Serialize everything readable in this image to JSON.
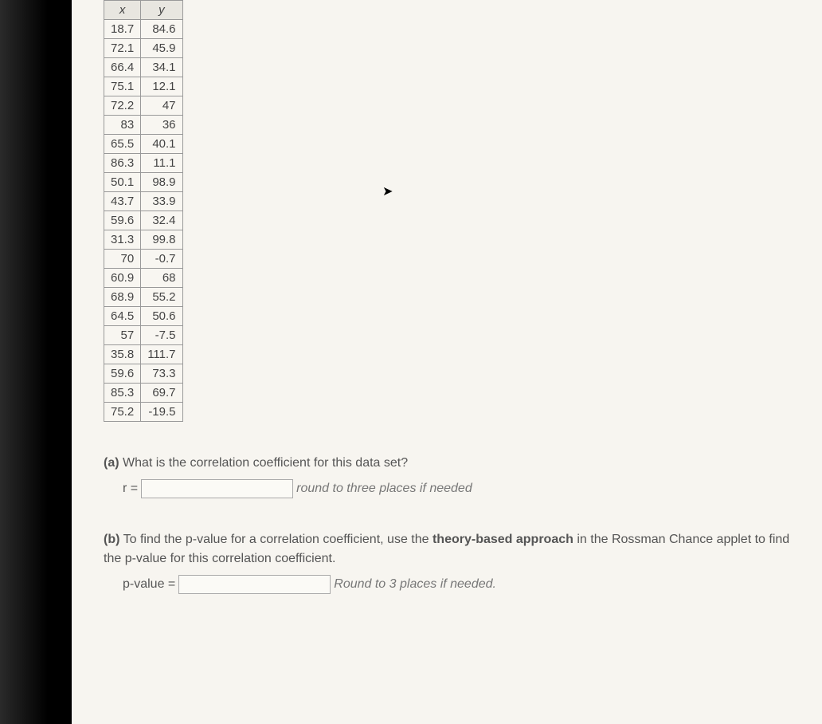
{
  "table": {
    "headers": [
      "x",
      "y"
    ],
    "rows": [
      [
        "18.7",
        "84.6"
      ],
      [
        "72.1",
        "45.9"
      ],
      [
        "66.4",
        "34.1"
      ],
      [
        "75.1",
        "12.1"
      ],
      [
        "72.2",
        "47"
      ],
      [
        "83",
        "36"
      ],
      [
        "65.5",
        "40.1"
      ],
      [
        "86.3",
        "11.1"
      ],
      [
        "50.1",
        "98.9"
      ],
      [
        "43.7",
        "33.9"
      ],
      [
        "59.6",
        "32.4"
      ],
      [
        "31.3",
        "99.8"
      ],
      [
        "70",
        "-0.7"
      ],
      [
        "60.9",
        "68"
      ],
      [
        "68.9",
        "55.2"
      ],
      [
        "64.5",
        "50.6"
      ],
      [
        "57",
        "-7.5"
      ],
      [
        "35.8",
        "111.7"
      ],
      [
        "59.6",
        "73.3"
      ],
      [
        "85.3",
        "69.7"
      ],
      [
        "75.2",
        "-19.5"
      ]
    ]
  },
  "question_a": {
    "label": "(a)",
    "text": "What is the correlation coefficient for this data set?",
    "var": "r =",
    "hint": "round to three places if needed"
  },
  "question_b": {
    "label": "(b)",
    "text_part1": "To find the p-value for a correlation coefficient, use the ",
    "bold": "theory-based approach",
    "text_part2": " in the Rossman Chance applet to find the p-value for this correlation coefficient.",
    "var": "p-value =",
    "hint": "Round to 3 places if needed."
  },
  "chart_data": {
    "type": "table",
    "columns": [
      "x",
      "y"
    ],
    "data": [
      [
        18.7,
        84.6
      ],
      [
        72.1,
        45.9
      ],
      [
        66.4,
        34.1
      ],
      [
        75.1,
        12.1
      ],
      [
        72.2,
        47
      ],
      [
        83,
        36
      ],
      [
        65.5,
        40.1
      ],
      [
        86.3,
        11.1
      ],
      [
        50.1,
        98.9
      ],
      [
        43.7,
        33.9
      ],
      [
        59.6,
        32.4
      ],
      [
        31.3,
        99.8
      ],
      [
        70,
        -0.7
      ],
      [
        60.9,
        68
      ],
      [
        68.9,
        55.2
      ],
      [
        64.5,
        50.6
      ],
      [
        57,
        -7.5
      ],
      [
        35.8,
        111.7
      ],
      [
        59.6,
        73.3
      ],
      [
        85.3,
        69.7
      ],
      [
        75.2,
        -19.5
      ]
    ]
  }
}
